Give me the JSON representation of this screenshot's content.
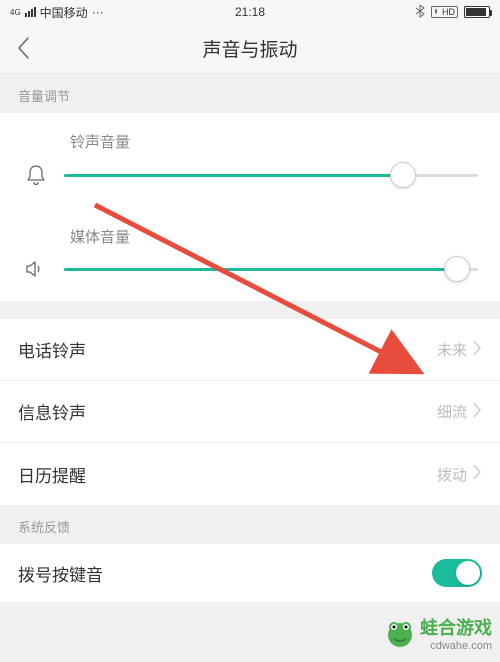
{
  "status": {
    "network_text": "4G",
    "carrier": "中国移动",
    "time": "21:18",
    "hd": "HD"
  },
  "header": {
    "title": "声音与振动"
  },
  "sections": {
    "volume": "音量调节",
    "feedback": "系统反馈"
  },
  "sliders": {
    "ringtone": {
      "label": "铃声音量",
      "percent": 82
    },
    "media": {
      "label": "媒体音量",
      "percent": 95
    }
  },
  "rows": {
    "phone": {
      "label": "电话铃声",
      "value": "未来"
    },
    "message": {
      "label": "信息铃声",
      "value": "细流"
    },
    "calendar": {
      "label": "日历提醒",
      "value": "拨动"
    },
    "dialpad": {
      "label": "拨号按键音"
    }
  },
  "watermark": {
    "brand": "蛙合游戏",
    "url": "cdwahe.com"
  }
}
